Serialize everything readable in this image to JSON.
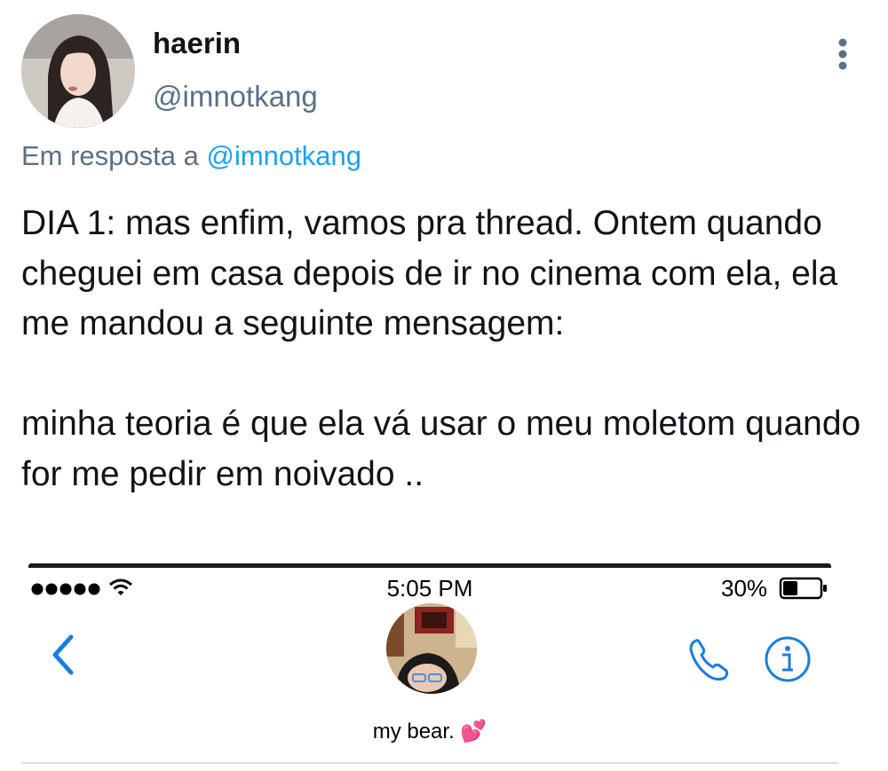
{
  "user": {
    "display_name": "haerin",
    "handle": "@imnotkang"
  },
  "reply": {
    "prefix": "Em resposta a",
    "mention": "@imnotkang"
  },
  "tweet": {
    "text": "DIA 1: mas enfim, vamos pra thread. Ontem quando cheguei em casa depois de ir no cinema com ela, ela me mandou a seguinte mensagem:\n\nminha teoria é que ela vá usar o meu moletom quando for me pedir em noivado .."
  },
  "embedded_screenshot": {
    "time": "5:05 PM",
    "battery": "30%",
    "contact_name": "my bear. 💕"
  },
  "colors": {
    "link": "#1da1f2",
    "secondary_text": "#5b7083",
    "ios_blue": "#1a7ddb"
  },
  "icons": [
    "more-vertical-icon",
    "signal-icon",
    "wifi-icon",
    "battery-icon",
    "back-chevron-icon",
    "phone-icon",
    "info-icon"
  ]
}
